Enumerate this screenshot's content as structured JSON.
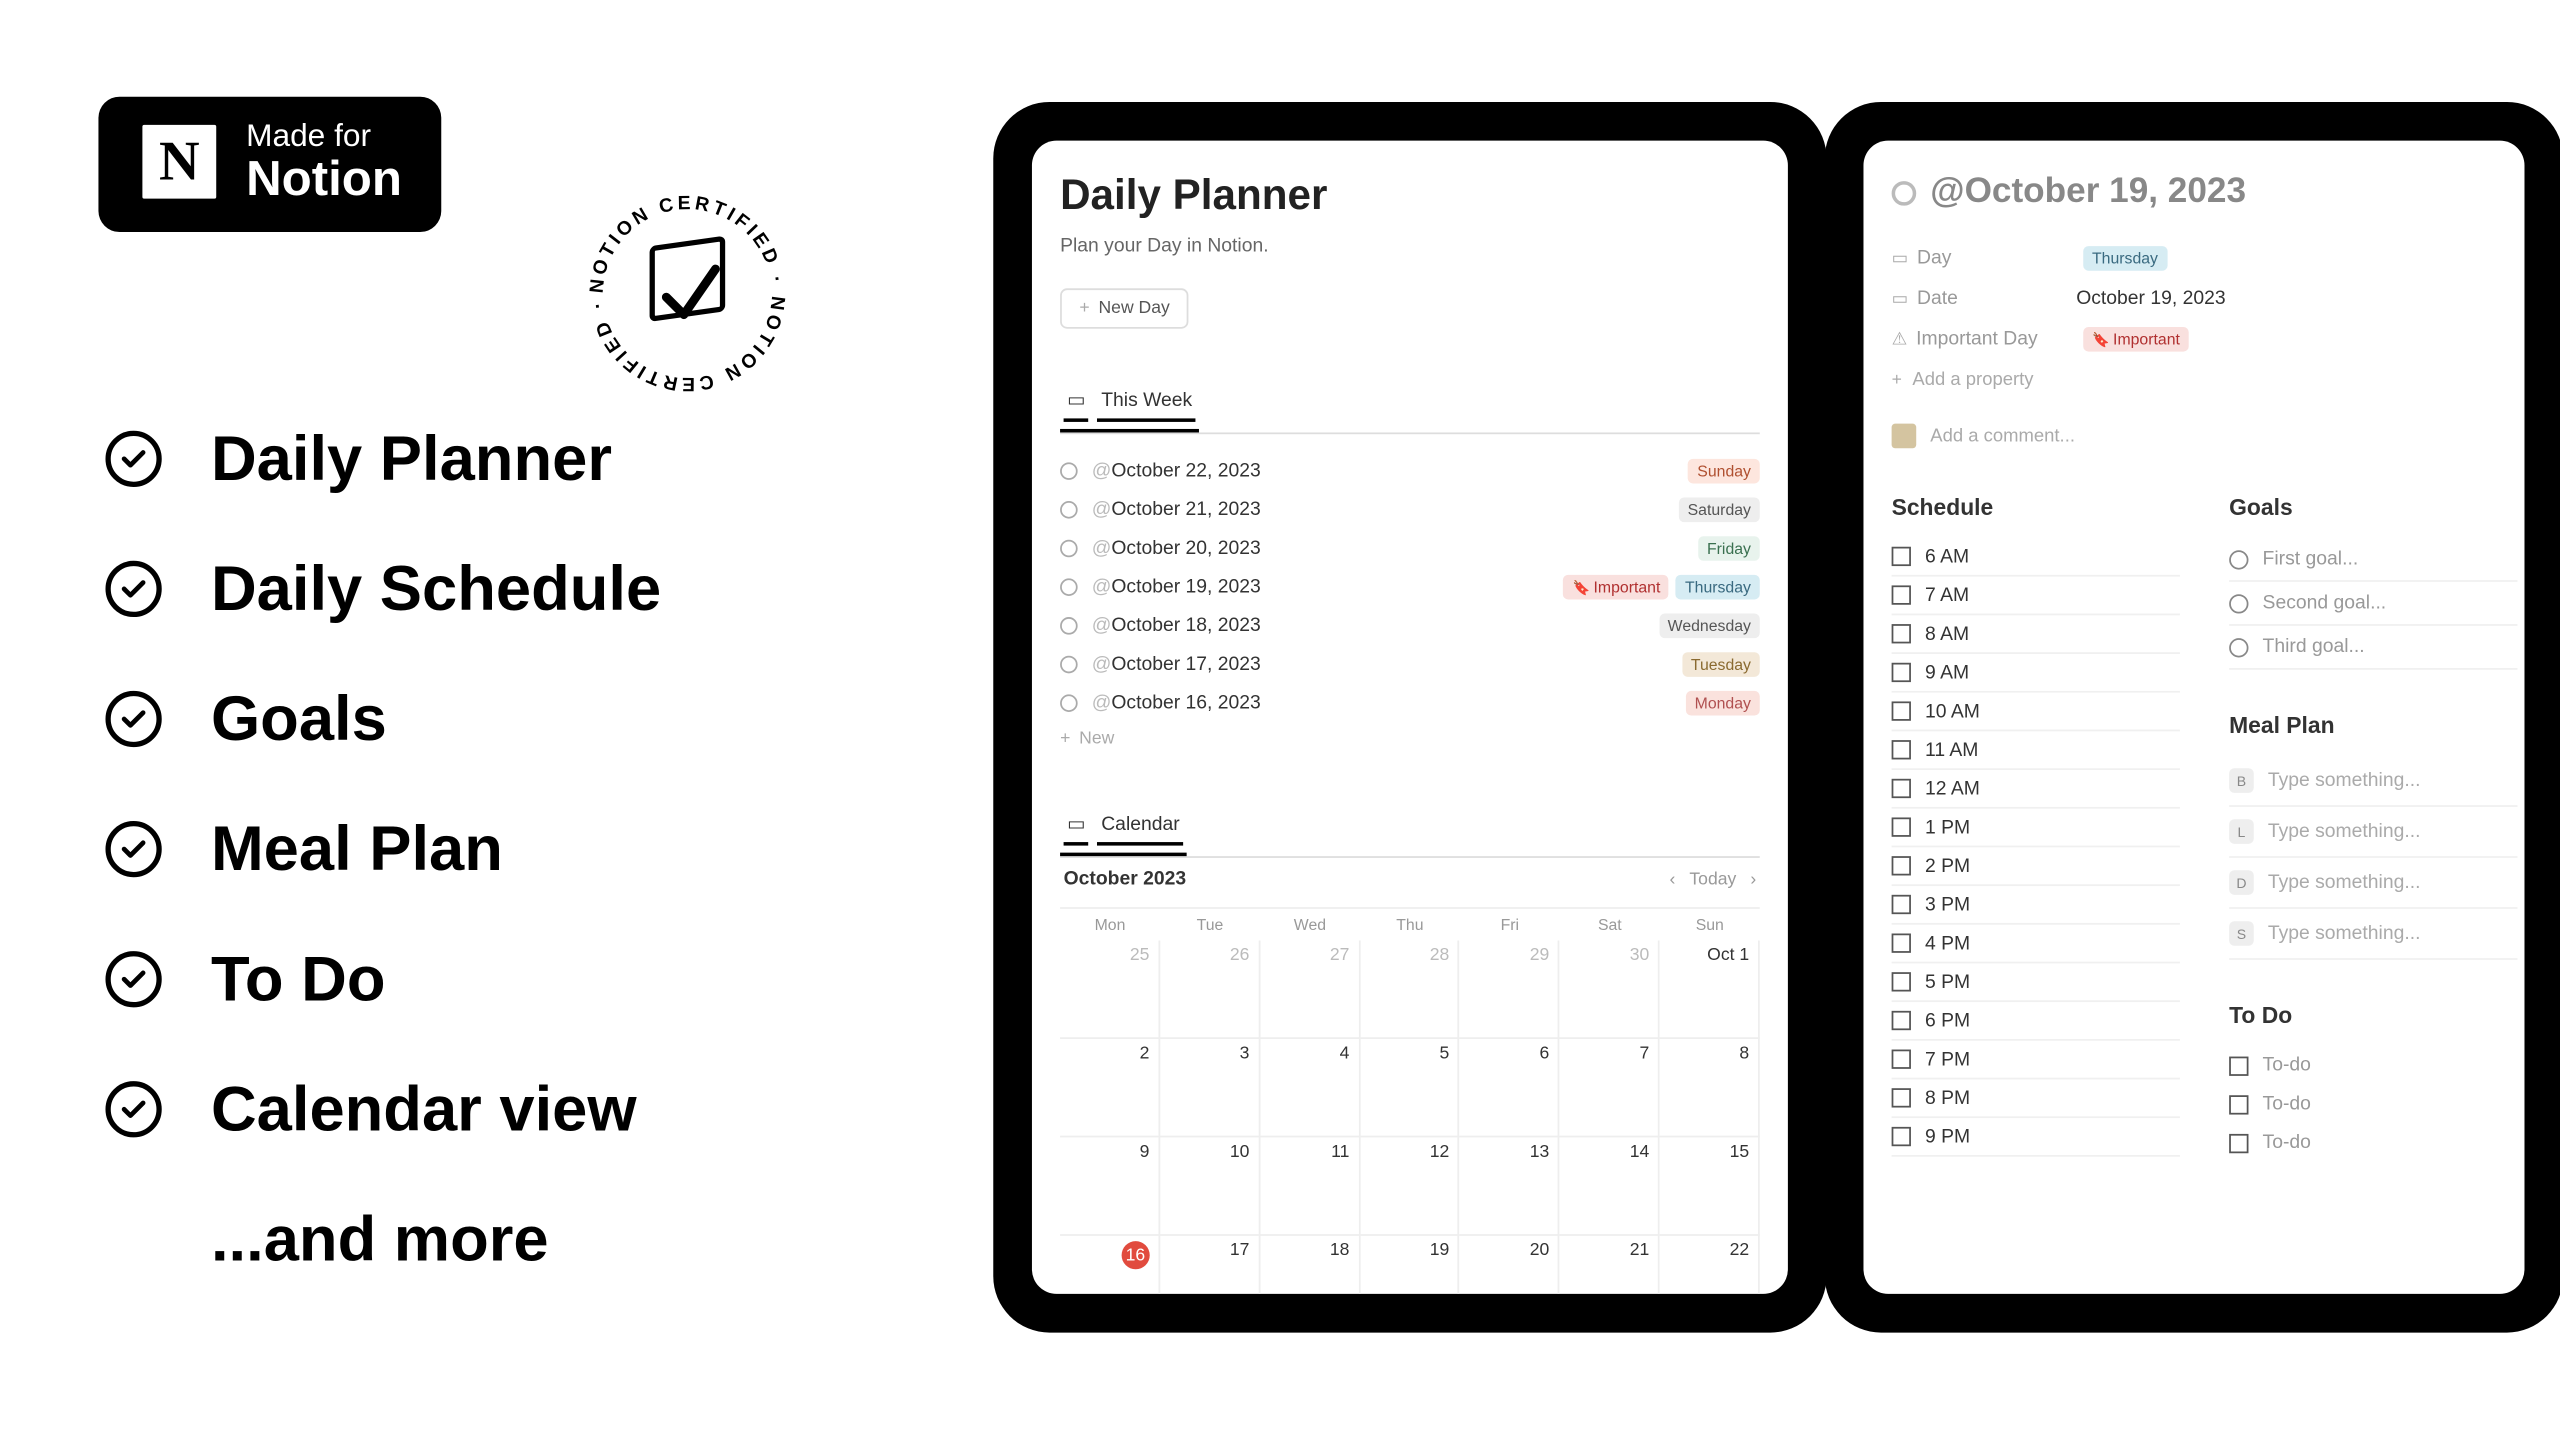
{
  "promo": {
    "badge": {
      "logo_letter": "N",
      "line1": "Made for",
      "line2": "Notion"
    },
    "cert_text": "NOTION CERTIFIED · NOTION CERTIFIED ·",
    "features": [
      "Daily Planner",
      "Daily Schedule",
      "Goals",
      "Meal Plan",
      "To Do",
      "Calendar view"
    ],
    "more": "...and more"
  },
  "planner": {
    "title": "Daily Planner",
    "subtitle": "Plan your Day in Notion.",
    "new_day_btn": "New Day",
    "this_week_tab": "This Week",
    "week": [
      {
        "date": "October 22, 2023",
        "tags": [
          {
            "txt": "Sunday",
            "cls": "sun"
          }
        ]
      },
      {
        "date": "October 21, 2023",
        "tags": [
          {
            "txt": "Saturday",
            "cls": "sat"
          }
        ]
      },
      {
        "date": "October 20, 2023",
        "tags": [
          {
            "txt": "Friday",
            "cls": "fri"
          }
        ]
      },
      {
        "date": "October 19, 2023",
        "tags": [
          {
            "txt": "Important",
            "cls": "imp"
          },
          {
            "txt": "Thursday",
            "cls": "thu"
          }
        ]
      },
      {
        "date": "October 18, 2023",
        "tags": [
          {
            "txt": "Wednesday",
            "cls": "wed"
          }
        ]
      },
      {
        "date": "October 17, 2023",
        "tags": [
          {
            "txt": "Tuesday",
            "cls": "tue"
          }
        ]
      },
      {
        "date": "October 16, 2023",
        "tags": [
          {
            "txt": "Monday",
            "cls": "mon"
          }
        ]
      }
    ],
    "new_label": "New",
    "calendar_tab": "Calendar",
    "month_label": "October 2023",
    "today_btn": "Today",
    "dow": [
      "Mon",
      "Tue",
      "Wed",
      "Thu",
      "Fri",
      "Sat",
      "Sun"
    ],
    "grid": [
      [
        "25",
        "26",
        "27",
        "28",
        "29",
        "30",
        "Oct 1"
      ],
      [
        "2",
        "3",
        "4",
        "5",
        "6",
        "7",
        "8"
      ],
      [
        "9",
        "10",
        "11",
        "12",
        "13",
        "14",
        "15"
      ],
      [
        "16",
        "17",
        "18",
        "19",
        "20",
        "21",
        "22"
      ]
    ],
    "today_cell": "16"
  },
  "day": {
    "title": "@October 19, 2023",
    "props": {
      "day_key": "Day",
      "day_val": "Thursday",
      "date_key": "Date",
      "date_val": "October 19, 2023",
      "imp_key": "Important Day",
      "imp_val": "Important",
      "add": "Add a property"
    },
    "comment_ph": "Add a comment...",
    "schedule_h": "Schedule",
    "schedule": [
      "6 AM",
      "7 AM",
      "8 AM",
      "9 AM",
      "10 AM",
      "11 AM",
      "12 AM",
      "1 PM",
      "2 PM",
      "3 PM",
      "4 PM",
      "5 PM",
      "6 PM",
      "7 PM",
      "8 PM",
      "9 PM"
    ],
    "goals_h": "Goals",
    "goals": [
      "First goal...",
      "Second goal...",
      "Third goal..."
    ],
    "meal_h": "Meal Plan",
    "meal_ph": "Type something...",
    "meal_badges": [
      "B",
      "L",
      "D",
      "S"
    ],
    "todo_h": "To Do",
    "todo_ph": "To-do",
    "todo_count": 3
  }
}
